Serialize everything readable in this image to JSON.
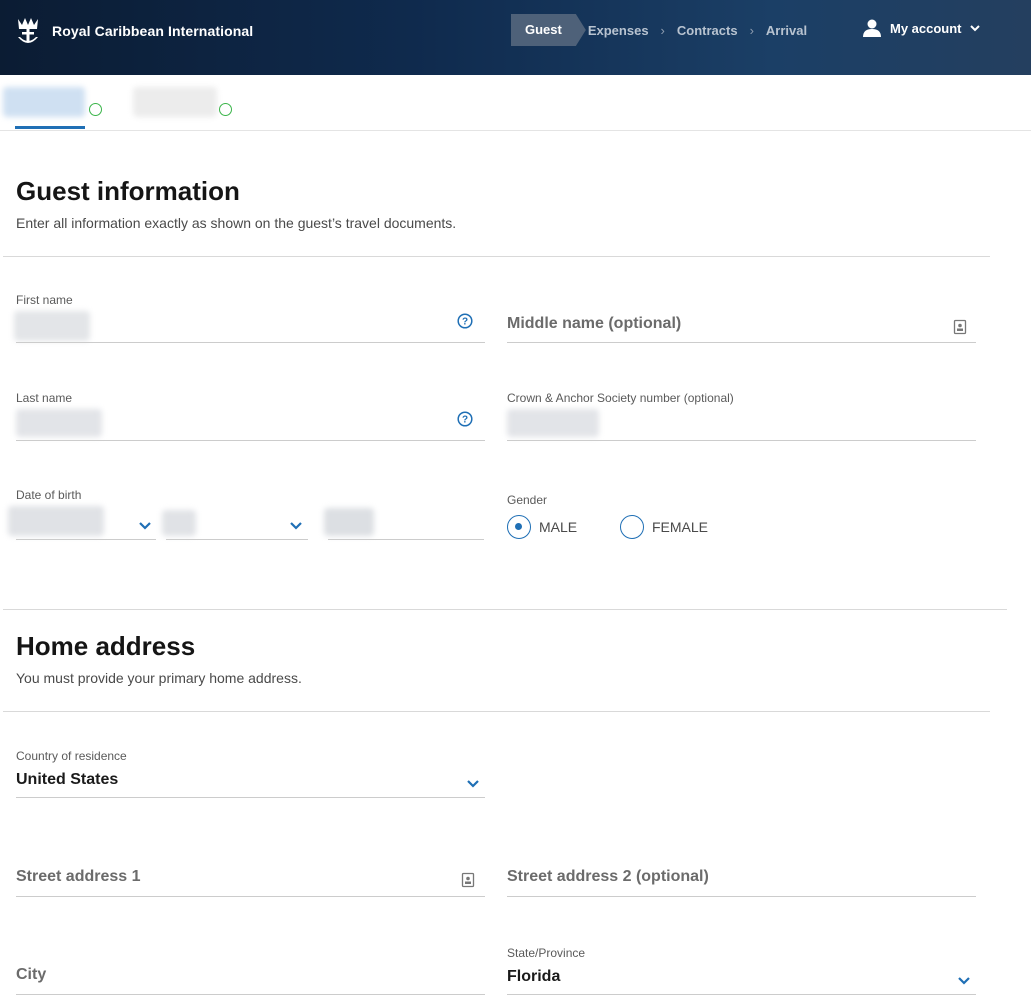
{
  "header": {
    "brand": "Royal Caribbean International",
    "steps": [
      {
        "label": "Guest",
        "active": true
      },
      {
        "label": "Expenses",
        "active": false
      },
      {
        "label": "Contracts",
        "active": false
      },
      {
        "label": "Arrival",
        "active": false
      }
    ],
    "account_label": "My account",
    "icons": {
      "logo": "crown-anchor-logo",
      "step_separator": "chevron-right-icon",
      "account": "user-icon",
      "account_caret": "chevron-down-icon"
    }
  },
  "colors": {
    "header_bg": "#0f2a4d",
    "active_step_bg": "#4e6179",
    "accent_blue": "#1f6fb5",
    "status_green": "#3bb54a"
  },
  "guest_info": {
    "title": "Guest information",
    "subtitle": "Enter all information exactly as shown on the guest’s travel documents.",
    "first_name_label": "First name",
    "middle_name_placeholder": "Middle name (optional)",
    "last_name_label": "Last name",
    "crown_anchor_label": "Crown & Anchor Society number (optional)",
    "dob_label": "Date of birth",
    "gender_label": "Gender",
    "gender_options": [
      "MALE",
      "FEMALE"
    ],
    "gender_selected": "MALE"
  },
  "home_address": {
    "title": "Home address",
    "subtitle": "You must provide your primary home address.",
    "country_label": "Country of residence",
    "country_value": "United States",
    "street1_placeholder": "Street address 1",
    "street2_placeholder": "Street address 2 (optional)",
    "city_placeholder": "City",
    "state_label": "State/Province",
    "state_value": "Florida"
  }
}
